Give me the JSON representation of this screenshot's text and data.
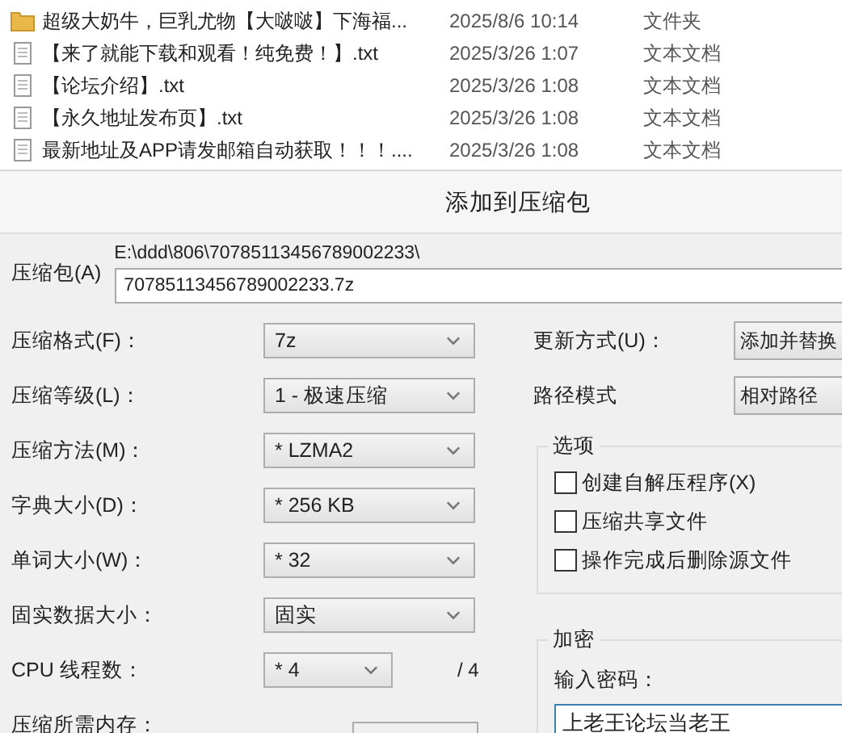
{
  "file_list": {
    "rows": [
      {
        "kind": "folder",
        "name": "超级大奶牛，巨乳尤物【大啵啵】下海福...",
        "date": "2025/8/6 10:14",
        "type": "文件夹"
      },
      {
        "kind": "text",
        "name": "【来了就能下载和观看！纯免费！】.txt",
        "date": "2025/3/26 1:07",
        "type": "文本文档"
      },
      {
        "kind": "text",
        "name": "【论坛介绍】.txt",
        "date": "2025/3/26 1:08",
        "type": "文本文档"
      },
      {
        "kind": "text",
        "name": "【永久地址发布页】.txt",
        "date": "2025/3/26 1:08",
        "type": "文本文档"
      },
      {
        "kind": "text",
        "name": "最新地址及APP请发邮箱自动获取！！！....",
        "date": "2025/3/26 1:08",
        "type": "文本文档"
      }
    ]
  },
  "dialog": {
    "title": "添加到压缩包",
    "archive": {
      "label": "压缩包(A)",
      "path": "E:\\ddd\\806\\70785113456789002233\\",
      "value": "70785113456789002233.7z"
    },
    "left_fields": [
      {
        "kind": "select",
        "label": "压缩格式(F)：",
        "value": "7z"
      },
      {
        "kind": "select",
        "label": "压缩等级(L)：",
        "value": "1 - 极速压缩"
      },
      {
        "kind": "select",
        "label": "压缩方法(M)：",
        "value": "* LZMA2"
      },
      {
        "kind": "select",
        "label": "字典大小(D)：",
        "value": "* 256 KB"
      },
      {
        "kind": "select",
        "label": "单词大小(W)：",
        "value": "* 32"
      },
      {
        "kind": "select",
        "label": "固实数据大小：",
        "value": "固实"
      },
      {
        "kind": "small_select",
        "label": "CPU 线程数：",
        "value": "* 4",
        "suffix": "/ 4"
      },
      {
        "kind": "readout",
        "label": "压缩所需内存："
      }
    ],
    "update_mode": {
      "label": "更新方式(U)：",
      "value": "添加并替换"
    },
    "path_mode": {
      "label": "路径模式",
      "value": "相对路径"
    },
    "options": {
      "title": "选项",
      "items": [
        {
          "label": "创建自解压程序(X)",
          "checked": false
        },
        {
          "label": "压缩共享文件",
          "checked": false
        },
        {
          "label": "操作完成后删除源文件",
          "checked": false
        }
      ]
    },
    "encryption": {
      "title": "加密",
      "password_label": "输入密码：",
      "password": "上老王论坛当老王"
    }
  }
}
